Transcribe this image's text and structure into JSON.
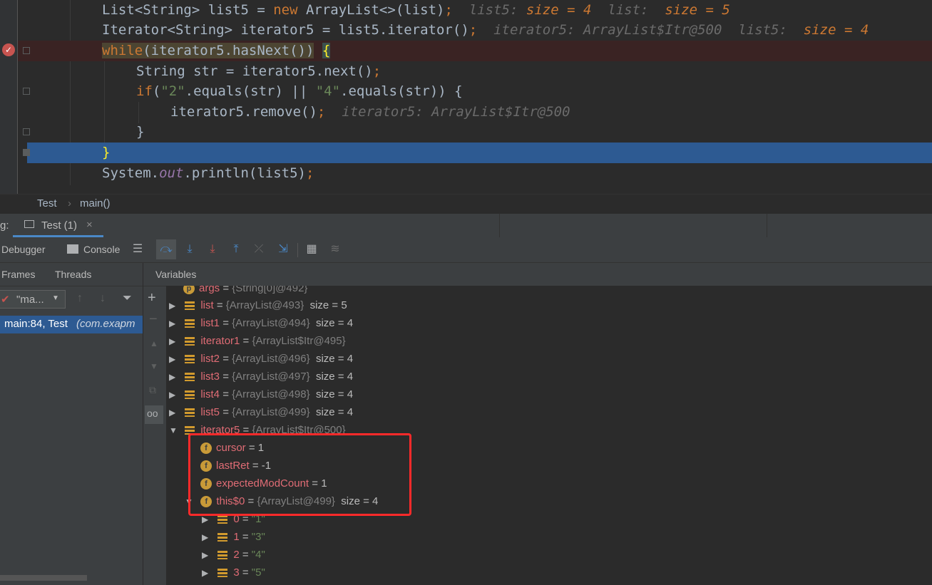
{
  "editor": {
    "lines": [
      {
        "code": "List<String> list5 = new ArrayList<>(list);",
        "hint": "list5:  size = 4  list:  size = 5"
      },
      {
        "code": "Iterator<String> iterator5 = list5.iterator();",
        "hint": "iterator5: ArrayList$Itr@500  list5:  size = 4"
      },
      {
        "code": "while(iterator5.hasNext()) {",
        "hint": ""
      },
      {
        "code": "String str = iterator5.next();",
        "hint": ""
      },
      {
        "code": "if(\"2\".equals(str) || \"4\".equals(str)) {",
        "hint": ""
      },
      {
        "code": "iterator5.remove();",
        "hint": "iterator5: ArrayList$Itr@500"
      },
      {
        "code": "}",
        "hint": ""
      },
      {
        "code": "}",
        "hint": ""
      },
      {
        "code": "System.out.println(list5);",
        "hint": ""
      }
    ]
  },
  "breadcrumb": {
    "class": "Test",
    "method": "main()"
  },
  "debug": {
    "label": "g:",
    "tab": "Test (1)",
    "toolbar": {
      "debugger": "Debugger",
      "console": "Console"
    },
    "frames_tab": "Frames",
    "threads_tab": "Threads",
    "thread_select": "\"ma...",
    "frame": "main:84, Test",
    "frame_pkg": "(com.exapm",
    "variables_tab": "Variables"
  },
  "variables": [
    {
      "name": "args",
      "type": "{String[0]@492}",
      "extra": "",
      "icon": "p"
    },
    {
      "name": "list",
      "type": "{ArrayList@493}",
      "extra": "size = 5",
      "icon": "lines"
    },
    {
      "name": "list1",
      "type": "{ArrayList@494}",
      "extra": "size = 4",
      "icon": "lines"
    },
    {
      "name": "iterator1",
      "type": "{ArrayList$Itr@495}",
      "extra": "",
      "icon": "lines"
    },
    {
      "name": "list2",
      "type": "{ArrayList@496}",
      "extra": "size = 4",
      "icon": "lines"
    },
    {
      "name": "list3",
      "type": "{ArrayList@497}",
      "extra": "size = 4",
      "icon": "lines"
    },
    {
      "name": "list4",
      "type": "{ArrayList@498}",
      "extra": "size = 4",
      "icon": "lines"
    },
    {
      "name": "list5",
      "type": "{ArrayList@499}",
      "extra": "size = 4",
      "icon": "lines"
    },
    {
      "name": "iterator5",
      "type": "{ArrayList$Itr@500}",
      "extra": "",
      "icon": "lines"
    }
  ],
  "iterator_fields": [
    {
      "name": "cursor",
      "value": "1"
    },
    {
      "name": "lastRet",
      "value": "-1"
    },
    {
      "name": "expectedModCount",
      "value": "1"
    },
    {
      "name": "this$0",
      "type": "{ArrayList@499}",
      "value": "size = 4"
    }
  ],
  "list_elements": [
    {
      "index": "0",
      "value": "\"1\""
    },
    {
      "index": "1",
      "value": "\"3\""
    },
    {
      "index": "2",
      "value": "\"4\""
    },
    {
      "index": "3",
      "value": "\"5\""
    }
  ],
  "colors": {
    "highlight": "#ff2a2a",
    "selection": "#2d5a92",
    "breakpoint_line": "#3a2323"
  }
}
